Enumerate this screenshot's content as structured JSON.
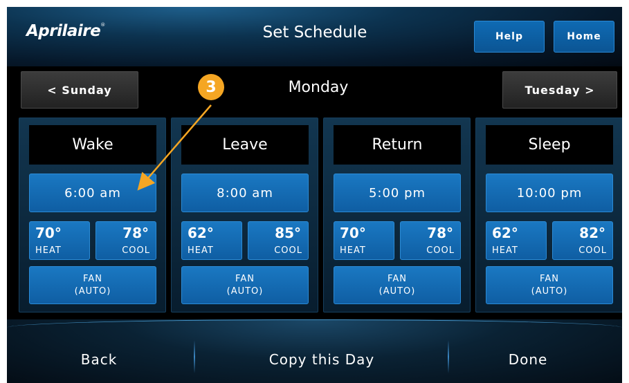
{
  "header": {
    "logo": "Aprilaire",
    "logo_mark": "®",
    "title": "Set Schedule",
    "help_label": "Help",
    "home_label": "Home"
  },
  "day_nav": {
    "prev_label": "< Sunday",
    "current_day": "Monday",
    "next_label": "Tuesday >"
  },
  "periods": [
    {
      "name": "Wake",
      "time": "6:00 am",
      "heat": "70°",
      "cool": "78°",
      "heat_label": "HEAT",
      "cool_label": "COOL",
      "fan_label": "FAN",
      "fan_mode": "(AUTO)"
    },
    {
      "name": "Leave",
      "time": "8:00 am",
      "heat": "62°",
      "cool": "85°",
      "heat_label": "HEAT",
      "cool_label": "COOL",
      "fan_label": "FAN",
      "fan_mode": "(AUTO)"
    },
    {
      "name": "Return",
      "time": "5:00 pm",
      "heat": "70°",
      "cool": "78°",
      "heat_label": "HEAT",
      "cool_label": "COOL",
      "fan_label": "FAN",
      "fan_mode": "(AUTO)"
    },
    {
      "name": "Sleep",
      "time": "10:00 pm",
      "heat": "62°",
      "cool": "82°",
      "heat_label": "HEAT",
      "cool_label": "COOL",
      "fan_label": "FAN",
      "fan_mode": "(AUTO)"
    }
  ],
  "footer": {
    "back_label": "Back",
    "copy_label": "Copy this Day",
    "done_label": "Done"
  },
  "annotation": {
    "callout_number": "3"
  },
  "colors": {
    "button_blue": "#1a78c2",
    "callout_orange": "#f5a623",
    "background": "#000000"
  }
}
